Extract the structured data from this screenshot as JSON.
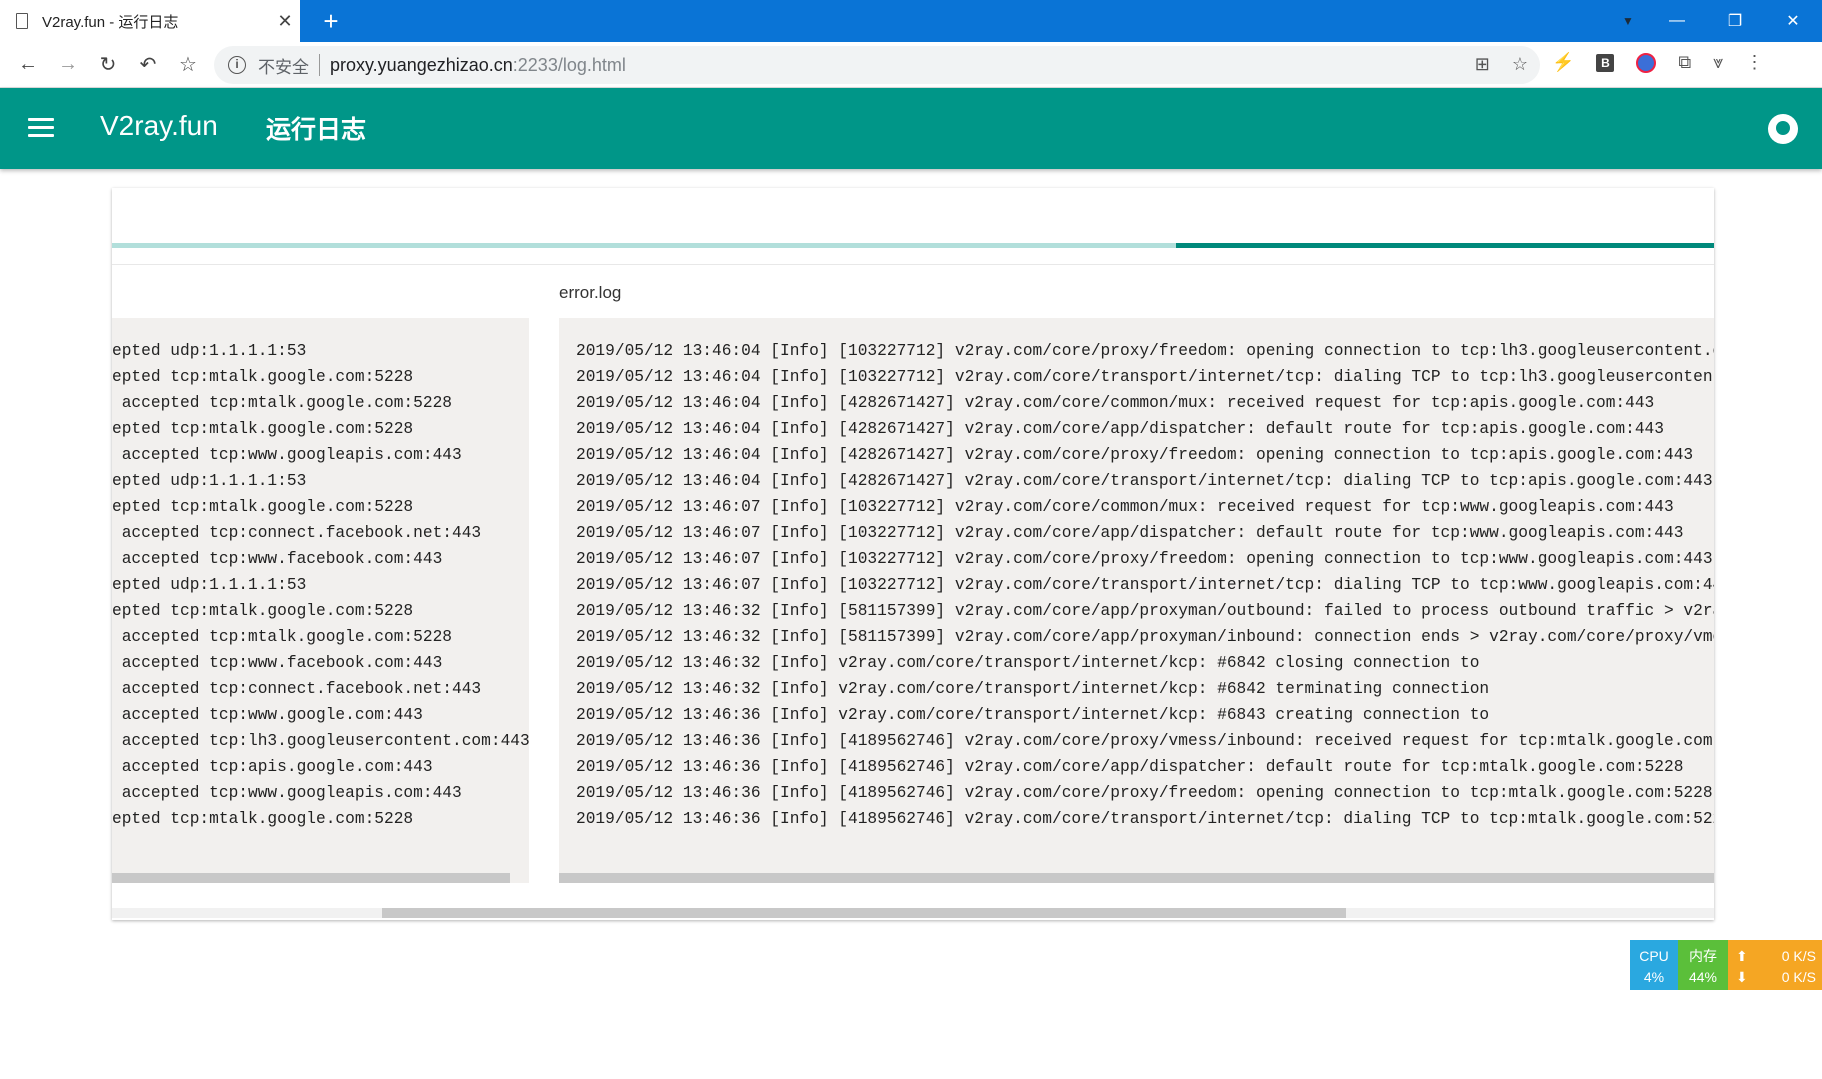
{
  "browser": {
    "tab_title": "V2ray.fun - 运行日志",
    "url_security": "不安全",
    "url_host": "proxy.yuangezhizao.cn",
    "url_rest": ":2233/log.html"
  },
  "appbar": {
    "app_name": "V2ray.fun",
    "page_title": "运行日志"
  },
  "access_pane": {
    "lines": [
      "epted udp:1.1.1.1:53",
      "epted tcp:mtalk.google.com:5228",
      " accepted tcp:mtalk.google.com:5228",
      "epted tcp:mtalk.google.com:5228",
      " accepted tcp:www.googleapis.com:443",
      "epted udp:1.1.1.1:53",
      "epted tcp:mtalk.google.com:5228",
      " accepted tcp:connect.facebook.net:443",
      " accepted tcp:www.facebook.com:443",
      "epted udp:1.1.1.1:53",
      "epted tcp:mtalk.google.com:5228",
      " accepted tcp:mtalk.google.com:5228",
      " accepted tcp:www.facebook.com:443",
      " accepted tcp:connect.facebook.net:443",
      " accepted tcp:www.google.com:443",
      " accepted tcp:lh3.googleusercontent.com:443",
      " accepted tcp:apis.google.com:443",
      " accepted tcp:www.googleapis.com:443",
      "epted tcp:mtalk.google.com:5228"
    ]
  },
  "error_pane": {
    "title": "error.log",
    "lines": [
      "2019/05/12 13:46:04 [Info] [103227712] v2ray.com/core/proxy/freedom: opening connection to tcp:lh3.googleusercontent.c",
      "2019/05/12 13:46:04 [Info] [103227712] v2ray.com/core/transport/internet/tcp: dialing TCP to tcp:lh3.googleusercontent",
      "2019/05/12 13:46:04 [Info] [4282671427] v2ray.com/core/common/mux: received request for tcp:apis.google.com:443",
      "2019/05/12 13:46:04 [Info] [4282671427] v2ray.com/core/app/dispatcher: default route for tcp:apis.google.com:443",
      "2019/05/12 13:46:04 [Info] [4282671427] v2ray.com/core/proxy/freedom: opening connection to tcp:apis.google.com:443",
      "2019/05/12 13:46:04 [Info] [4282671427] v2ray.com/core/transport/internet/tcp: dialing TCP to tcp:apis.google.com:443",
      "2019/05/12 13:46:07 [Info] [103227712] v2ray.com/core/common/mux: received request for tcp:www.googleapis.com:443",
      "2019/05/12 13:46:07 [Info] [103227712] v2ray.com/core/app/dispatcher: default route for tcp:www.googleapis.com:443",
      "2019/05/12 13:46:07 [Info] [103227712] v2ray.com/core/proxy/freedom: opening connection to tcp:www.googleapis.com:443",
      "2019/05/12 13:46:07 [Info] [103227712] v2ray.com/core/transport/internet/tcp: dialing TCP to tcp:www.googleapis.com:44",
      "2019/05/12 13:46:32 [Info] [581157399] v2ray.com/core/app/proxyman/outbound: failed to process outbound traffic > v2ra",
      "2019/05/12 13:46:32 [Info] [581157399] v2ray.com/core/app/proxyman/inbound: connection ends > v2ray.com/core/proxy/vme",
      "2019/05/12 13:46:32 [Info] v2ray.com/core/transport/internet/kcp: #6842 closing connection to",
      "2019/05/12 13:46:32 [Info] v2ray.com/core/transport/internet/kcp: #6842 terminating connection",
      "2019/05/12 13:46:36 [Info] v2ray.com/core/transport/internet/kcp: #6843 creating connection to",
      "2019/05/12 13:46:36 [Info] [4189562746] v2ray.com/core/proxy/vmess/inbound: received request for tcp:mtalk.google.com:",
      "2019/05/12 13:46:36 [Info] [4189562746] v2ray.com/core/app/dispatcher: default route for tcp:mtalk.google.com:5228",
      "2019/05/12 13:46:36 [Info] [4189562746] v2ray.com/core/proxy/freedom: opening connection to tcp:mtalk.google.com:5228",
      "2019/05/12 13:46:36 [Info] [4189562746] v2ray.com/core/transport/internet/tcp: dialing TCP to tcp:mtalk.google.com:522"
    ]
  },
  "progress": {
    "value": 0.664
  },
  "monitor": {
    "cpu_label": "CPU",
    "cpu_value": "4%",
    "mem_label": "内存",
    "mem_value": "44%",
    "up_speed": "0 K/S",
    "down_speed": "0 K/S"
  }
}
